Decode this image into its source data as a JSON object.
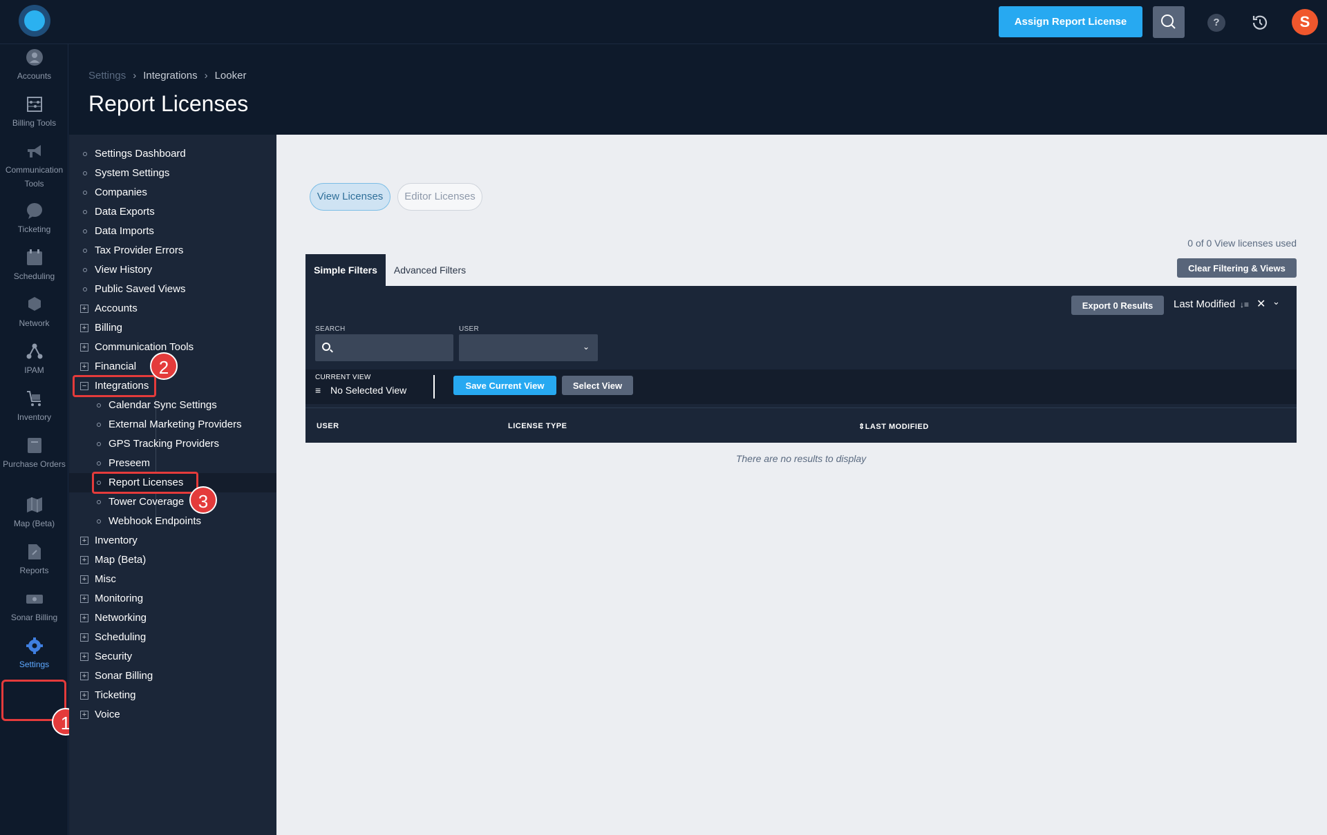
{
  "topbar": {
    "assign_button": "Assign Report License",
    "help_glyph": "?",
    "avatar_initial": "S"
  },
  "rail": {
    "items": [
      {
        "label": "Accounts",
        "icon": "user-icon"
      },
      {
        "label": "Billing Tools",
        "icon": "abacus-icon"
      },
      {
        "label": "Communication Tools",
        "icon": "megaphone-icon"
      },
      {
        "label": "Ticketing",
        "icon": "chat-bubble-icon"
      },
      {
        "label": "Scheduling",
        "icon": "calendar-icon"
      },
      {
        "label": "Network",
        "icon": "network-icon"
      },
      {
        "label": "IPAM",
        "icon": "hierarchy-icon"
      },
      {
        "label": "Inventory",
        "icon": "cart-icon"
      },
      {
        "label": "Purchase Orders",
        "icon": "clipboard-icon"
      },
      {
        "label": "Map (Beta)",
        "icon": "map-icon"
      },
      {
        "label": "Reports",
        "icon": "document-icon"
      },
      {
        "label": "Sonar Billing",
        "icon": "money-icon"
      },
      {
        "label": "Settings",
        "icon": "gear-icon"
      }
    ]
  },
  "breadcrumb": {
    "items": [
      "Settings",
      "Integrations",
      "Looker"
    ],
    "separator": "›"
  },
  "page_title": "Report Licenses",
  "tree": {
    "top_items": [
      "Settings Dashboard",
      "System Settings",
      "Companies",
      "Data Exports",
      "Data Imports",
      "Tax Provider Errors",
      "View History",
      "Public Saved Views"
    ],
    "groups_before": [
      "Accounts",
      "Billing",
      "Communication Tools",
      "Financial"
    ],
    "expanded_group": "Integrations",
    "children": [
      "Calendar Sync Settings",
      "External Marketing Providers",
      "GPS Tracking Providers",
      "Preseem",
      "Report Licenses",
      "Tower Coverage",
      "Webhook Endpoints"
    ],
    "groups_after": [
      "Inventory",
      "Map (Beta)",
      "Misc",
      "Monitoring",
      "Networking",
      "Scheduling",
      "Security",
      "Sonar Billing",
      "Ticketing",
      "Voice"
    ]
  },
  "annotations": [
    "1",
    "2",
    "3"
  ],
  "main": {
    "pills": {
      "view": "View Licenses",
      "editor": "Editor Licenses"
    },
    "licenses_used": "0 of 0 View licenses used",
    "tabs": {
      "simple": "Simple Filters",
      "advanced": "Advanced Filters"
    },
    "clear_button": "Clear Filtering & Views",
    "export_button": "Export 0 Results",
    "sort": {
      "label": "Last Modified",
      "sort_glyph": "↓≡",
      "clear_glyph": "✕",
      "chevron_glyph": "⌄"
    },
    "search_label": "SEARCH",
    "user_label": "USER",
    "current_view_label": "CURRENT VIEW",
    "current_view_value": "No Selected View",
    "save_view_button": "Save Current View",
    "select_view_button": "Select View",
    "columns": [
      "USER",
      "LICENSE TYPE",
      "⇕LAST MODIFIED"
    ],
    "empty_message": "There are no results to display"
  },
  "colors": {
    "accent": "#27a9f1",
    "annotation": "#e43b3b",
    "sidebar": "#1b2638",
    "topbar": "#0e1a2b"
  }
}
